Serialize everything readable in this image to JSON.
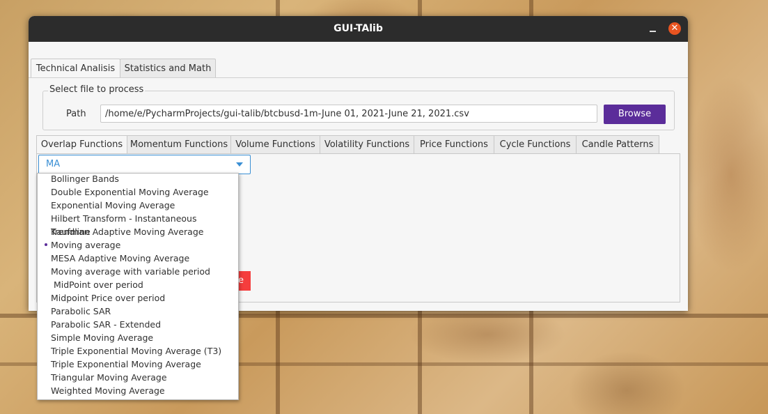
{
  "window": {
    "title": "GUI-TAlib",
    "minimize_icon": "minimize-icon",
    "close_icon": "close-icon",
    "close_color": "#e95420"
  },
  "outer_tabs": [
    {
      "label": "Technical Analisis",
      "active": true
    },
    {
      "label": "Statistics and Math",
      "active": false
    }
  ],
  "file_group": {
    "title": "Select file to process",
    "path_label": "Path",
    "path_value": "/home/e/PycharmProjects/gui-talib/btcbusd-1m-June 01, 2021-June 21, 2021.csv",
    "browse_label": "Browse",
    "browse_color": "#5b2d9a"
  },
  "inner_tabs": [
    {
      "label": "Overlap Functions",
      "active": true
    },
    {
      "label": "Momentum Functions",
      "active": false
    },
    {
      "label": "Volume Functions",
      "active": false
    },
    {
      "label": "Volatility Functions",
      "active": false
    },
    {
      "label": "Price Functions",
      "active": false
    },
    {
      "label": "Cycle Functions",
      "active": false
    },
    {
      "label": "Candle Patterns",
      "active": false
    }
  ],
  "function_select": {
    "value": "MA",
    "options": [
      "Bollinger Bands",
      "Double Exponential Moving Average",
      "Exponential Moving Average",
      "Hilbert Transform - Instantaneous Trendline",
      "Kaufman Adaptive Moving Average",
      "Moving average",
      "MESA Adaptive Moving Average",
      "Moving average with variable period",
      " MidPoint over period",
      "Midpoint Price over period",
      "Parabolic SAR",
      "Parabolic SAR - Extended",
      "Simple Moving Average",
      "Triple Exponential Moving Average (T3)",
      "Triple Exponential Moving Average",
      "Triangular Moving Average",
      "Weighted Moving Average"
    ],
    "selected_index": 5
  },
  "partially_hidden_button": {
    "visible_text": "e",
    "color": "#f53d3d"
  }
}
